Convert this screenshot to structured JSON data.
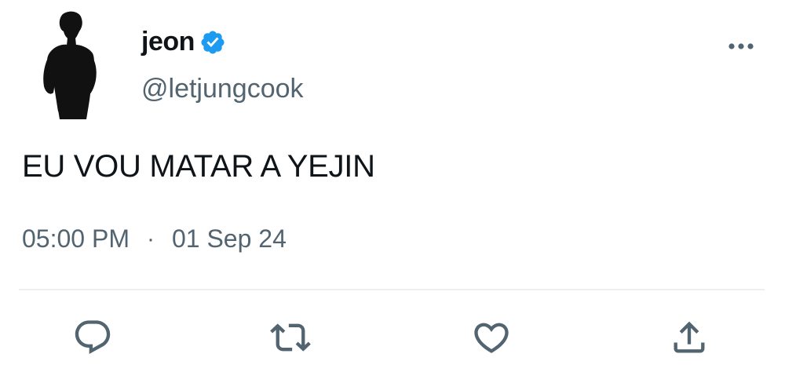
{
  "author": {
    "display_name": "jeon",
    "handle": "@letjungcook",
    "verified": true
  },
  "tweet": {
    "text": "EU VOU MATAR A YEJIN",
    "time": "05:00 PM",
    "separator": "·",
    "date": "01 Sep 24"
  },
  "actions": [
    {
      "name": "reply",
      "icon": "speech-bubble-icon"
    },
    {
      "name": "retweet",
      "icon": "retweet-arrows-icon"
    },
    {
      "name": "like",
      "icon": "heart-icon"
    },
    {
      "name": "share",
      "icon": "share-upload-icon"
    }
  ],
  "colors": {
    "text_primary": "#0f1419",
    "text_secondary": "#536471",
    "verified": "#1d9bf0",
    "icon": "#536471",
    "divider": "#eceef0"
  }
}
